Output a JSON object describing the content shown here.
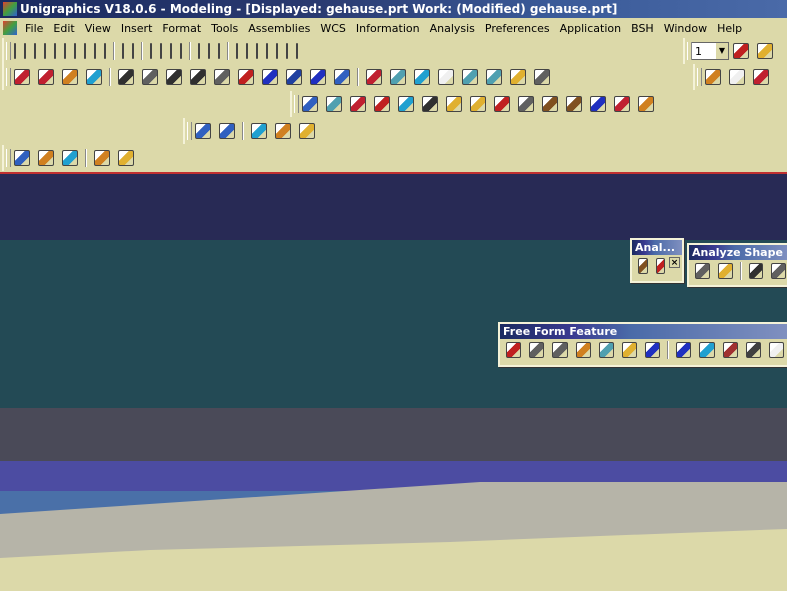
{
  "window": {
    "title": "Unigraphics V18.0.6 - Modeling - [Displayed: gehause.prt   Work: (Modified) gehause.prt]"
  },
  "menu": [
    "File",
    "Edit",
    "View",
    "Insert",
    "Format",
    "Tools",
    "Assemblies",
    "WCS",
    "Information",
    "Analysis",
    "Preferences",
    "Application",
    "BSH",
    "Window",
    "Help"
  ],
  "toolbars": {
    "standard": [
      "new-icon",
      "open-icon",
      "save-icon",
      "print-icon",
      "delete-icon",
      "undo-icon",
      "edit-icon",
      "info-icon",
      "tree-icon",
      "tree2-icon",
      "|",
      "fit-icon",
      "zoom-icon",
      "|",
      "shade-icon",
      "cube-icon",
      "color-icon",
      "sphere-icon",
      "|",
      "view-iso-icon",
      "view-top-icon",
      "view-front-icon",
      "|",
      "view-right-icon",
      "view-left-icon",
      "view-back-icon",
      "view-bottom-icon",
      "view-other-icon",
      "view-tri-icon",
      "view-ortho-icon"
    ],
    "layer_value": "1",
    "standard_right": [
      "layer-settings-icon",
      "layer-move-icon"
    ],
    "curve": [
      "sketch-icon",
      "point-icon",
      "spline-icon",
      "plus-icon",
      "|",
      "extrude-icon",
      "revolve-icon",
      "sweep-icon",
      "tube-icon",
      "hole-icon",
      "boss-icon",
      "pocket-icon",
      "pad-icon",
      "slot-icon",
      "groove-icon",
      "|",
      "blend-icon",
      "chamfer-icon",
      "trim-icon",
      "offset-icon",
      "line-icon",
      "arc-icon",
      "rect-icon",
      "curve-icon"
    ],
    "curve_right": [
      "assembly-icon",
      "component-icon",
      "mate-icon"
    ],
    "feature": [
      "block-icon",
      "cylinder-icon",
      "cone-icon",
      "sphere-prim-icon",
      "box-icon",
      "pattern-icon",
      "array-icon",
      "book-icon",
      "mirror-icon",
      "move-icon",
      "rotate-icon",
      "shell-icon",
      "unite-icon",
      "subtract-icon",
      "intersect-icon"
    ],
    "render": [
      "light-icon",
      "crop-icon",
      "|",
      "tiff-icon",
      "jpeg-icon",
      "export-icon"
    ],
    "drafting": [
      "draft-icon",
      "section-icon",
      "hatch-icon",
      "|",
      "bend-icon",
      "flange-icon"
    ]
  },
  "floating": {
    "analysis": {
      "title": "Anal...",
      "icons": [
        "measure-distance-icon",
        "measure-angle-icon"
      ]
    },
    "analyze_shape": {
      "title": "Analyze Shape",
      "icons": [
        "face-analysis-icon",
        "reflection-icon",
        "|",
        "curvature-icon",
        "deviation-icon"
      ]
    },
    "free_form": {
      "title": "Free Form Feature",
      "icons": [
        "through-curves-icon",
        "through-mesh-icon",
        "from-points-icon",
        "swept-icon",
        "ruled-icon",
        "bridge-icon",
        "offset-face-icon",
        "|",
        "face-grid-icon",
        "trimmed-sheet-icon",
        "extension-icon",
        "enlarge-icon",
        "law-extension-icon"
      ]
    }
  },
  "colors": {
    "viewport": [
      "#282a55",
      "#234a55",
      "#4a4a58",
      "#4c4ca2",
      "#4a70a8",
      "#b6b4a8",
      "#dcd9a9"
    ]
  }
}
